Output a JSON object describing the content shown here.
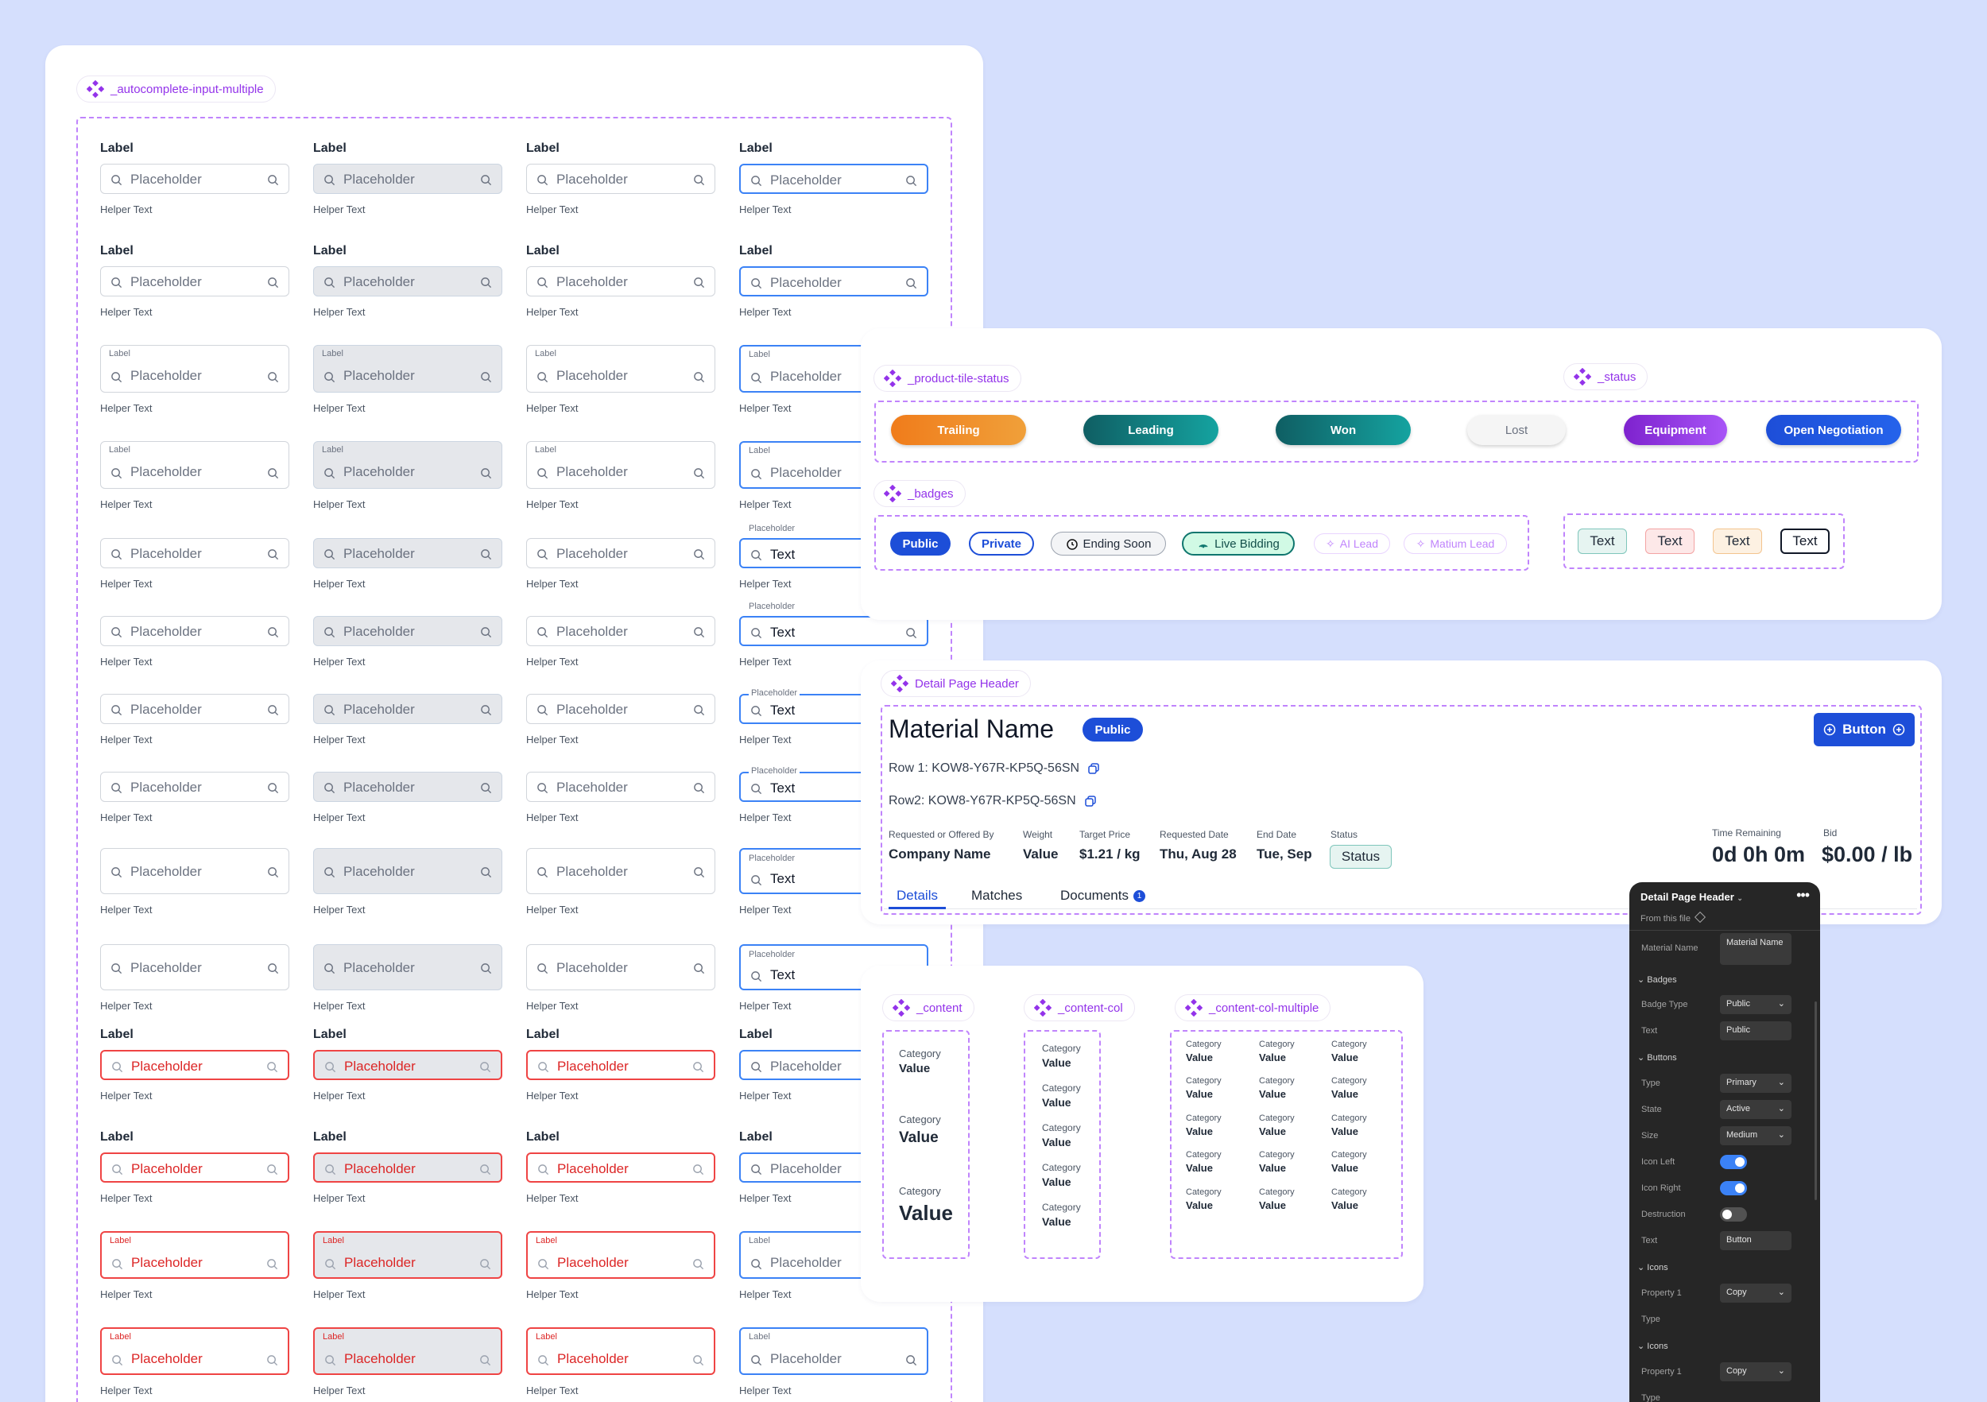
{
  "inputs": {
    "tag": "_autocomplete-input-multiple",
    "label": "Label",
    "placeholder": "Placeholder",
    "helper": "Helper Text",
    "value": "Text"
  },
  "product_tile_status": {
    "tag": "_product-tile-status",
    "items": [
      {
        "label": "Trailing",
        "color": "#f0861f"
      },
      {
        "label": "Leading",
        "color": "#0f766e"
      },
      {
        "label": "Won",
        "color": "#0f766e"
      },
      {
        "label": "Lost",
        "color": "#f3f4f6"
      },
      {
        "label": "Equipment",
        "color": "#9333ea"
      },
      {
        "label": "Open Negotiation",
        "color": "#1d4ed8"
      }
    ]
  },
  "status": {
    "tag": "_status"
  },
  "badges": {
    "tag": "_badges",
    "items": [
      "Public",
      "Private",
      "Ending Soon",
      "Live Bidding",
      "AI Lead",
      "Matium Lead"
    ],
    "text_badges": [
      "Text",
      "Text",
      "Text",
      "Text"
    ]
  },
  "detail_header": {
    "tag": "Detail Page Header",
    "title": "Material Name",
    "badge": "Public",
    "button": "Button",
    "row1": "Row 1: KOW8-Y67R-KP5Q-56SN",
    "row2": "Row2:  KOW8-Y67R-KP5Q-56SN",
    "fields": [
      {
        "label": "Requested or Offered By",
        "value": "Company Name"
      },
      {
        "label": "Weight",
        "value": "Value"
      },
      {
        "label": "Target Price",
        "value": "$1.21 / kg"
      },
      {
        "label": "Requested Date",
        "value": "Thu, Aug 28"
      },
      {
        "label": "End Date",
        "value": "Tue, Sep"
      },
      {
        "label": "Status",
        "value": "Status"
      }
    ],
    "time_label": "Time Remaining",
    "time_value": "0d 0h 0m",
    "bid_label": "Bid",
    "bid_value": "$0.00 / lb",
    "tabs": [
      "Details",
      "Matches",
      "Documents"
    ],
    "documents_count": "1"
  },
  "content": {
    "tag_content": "_content",
    "tag_col": "_content-col",
    "tag_col_multiple": "_content-col-multiple",
    "category": "Category",
    "value": "Value"
  },
  "props_panel": {
    "title": "Detail Page Header",
    "from": "From this file",
    "material_name_label": "Material Name",
    "material_name_value": "Material Name",
    "badges_section": "Badges",
    "badge_type_label": "Badge Type",
    "badge_type_value": "Public",
    "text_label": "Text",
    "text_value": "Public",
    "buttons_section": "Buttons",
    "type_label": "Type",
    "type_value": "Primary",
    "state_label": "State",
    "state_value": "Active",
    "size_label": "Size",
    "size_value": "Medium",
    "icon_left_label": "Icon Left",
    "icon_right_label": "Icon Right",
    "destruction_label": "Destruction",
    "button_text_label": "Text",
    "button_text_value": "Button",
    "icons_section": "Icons",
    "property1_label": "Property 1",
    "property1_value": "Copy",
    "type2_label": "Type",
    "icons_section2": "Icons",
    "property1b_label": "Property 1",
    "property1b_value": "Copy",
    "type3_label": "Type"
  }
}
